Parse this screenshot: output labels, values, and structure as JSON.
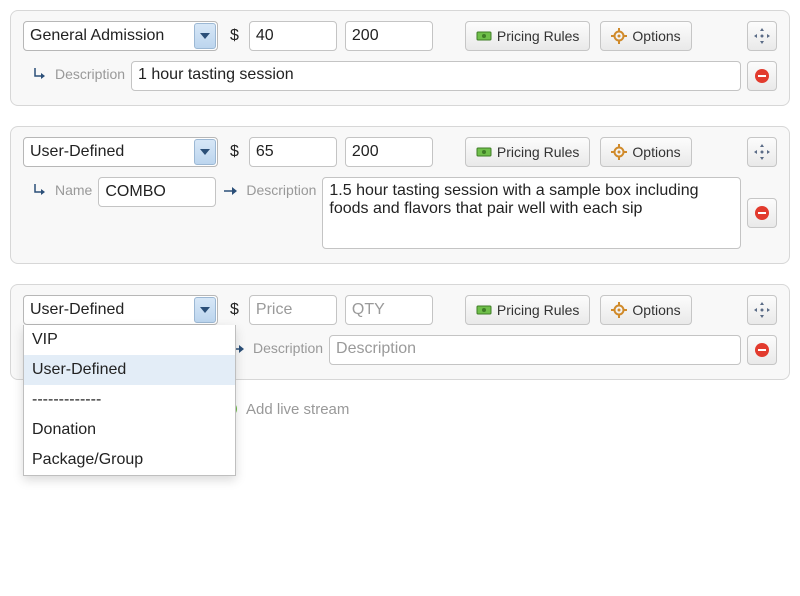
{
  "buttons": {
    "pricing_rules": "Pricing Rules",
    "options": "Options",
    "add_live_stream": "Add live stream"
  },
  "labels": {
    "description": "Description",
    "name": "Name"
  },
  "placeholders": {
    "price": "Price",
    "qty": "QTY",
    "description": "Description"
  },
  "dropdown_options": [
    "VIP",
    "User-Defined",
    "-------------",
    "Donation",
    "Package/Group"
  ],
  "rows": [
    {
      "type": "General Admission",
      "price": "40",
      "qty": "200",
      "description": "1 hour tasting session"
    },
    {
      "type": "User-Defined",
      "price": "65",
      "qty": "200",
      "name": "COMBO",
      "description": "1.5 hour tasting session with a sample box including foods and flavors that pair well with each sip"
    },
    {
      "type": "User-Defined",
      "price": "",
      "qty": "",
      "name": "",
      "description": ""
    }
  ]
}
